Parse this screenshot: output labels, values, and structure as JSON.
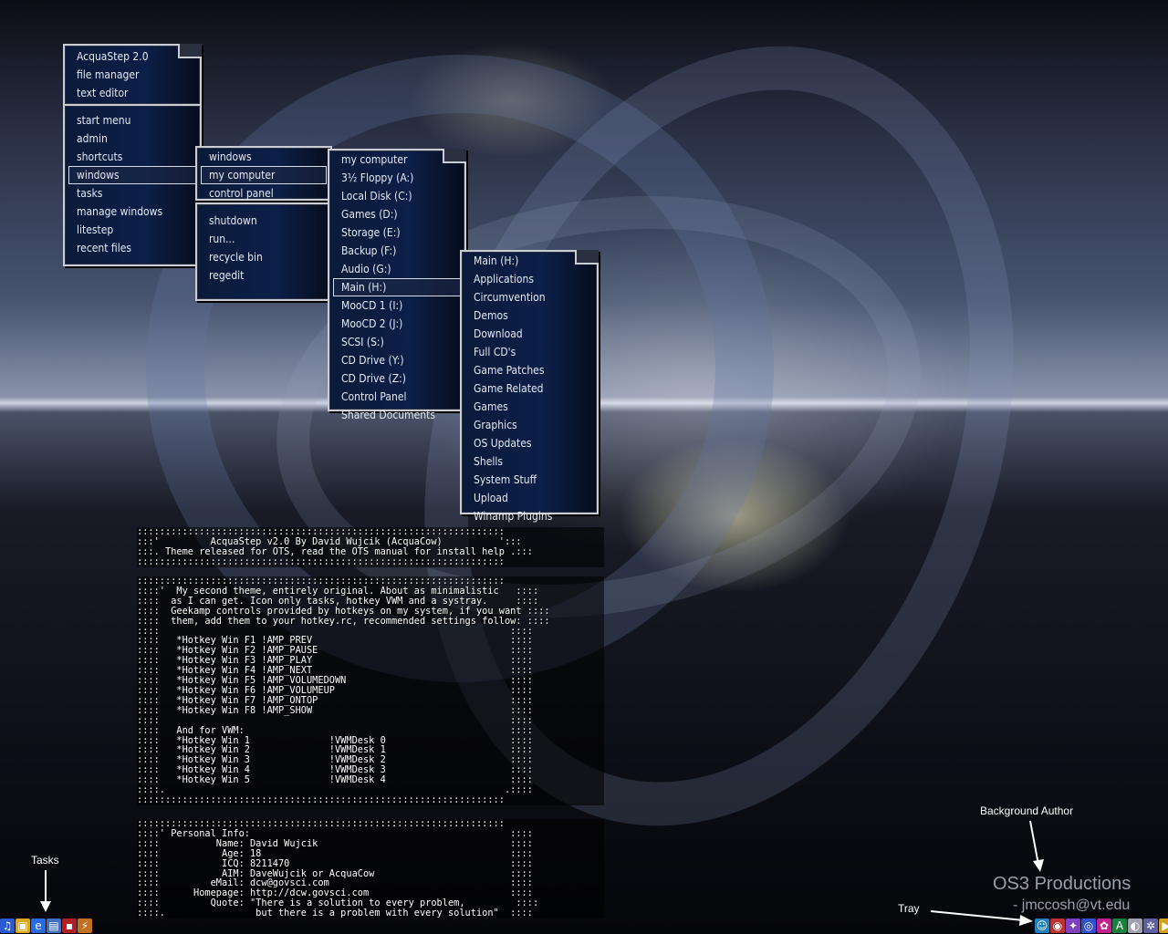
{
  "menus": {
    "start": {
      "groups": [
        [
          "AcquaStep 2.0",
          "file manager",
          "text editor"
        ],
        [
          "start menu",
          "admin",
          "shortcuts",
          "windows",
          "tasks",
          "manage windows",
          "litestep",
          "recent files"
        ]
      ],
      "active": "windows"
    },
    "windows": {
      "groups": [
        [
          "windows",
          "my computer",
          "control panel"
        ],
        [
          "shutdown",
          "run...",
          "recycle bin",
          "regedit"
        ]
      ],
      "active": "my computer"
    },
    "my_computer": {
      "items": [
        "my computer",
        "3½ Floppy (A:)",
        "Local Disk (C:)",
        "Games (D:)",
        "Storage (E:)",
        "Backup (F:)",
        "Audio (G:)",
        "Main (H:)",
        "MooCD 1 (I:)",
        "MooCD 2 (J:)",
        "SCSI (S:)",
        "CD Drive (Y:)",
        "CD Drive (Z:)",
        "Control Panel",
        "Shared Documents"
      ],
      "active": "Main (H:)"
    },
    "main_h": {
      "items": [
        "Main (H:)",
        "Applications",
        "Circumvention",
        "Demos",
        "Download",
        "Full CD's",
        "Game Patches",
        "Game Related",
        "Games",
        "Graphics",
        "OS Updates",
        "Shells",
        "System Stuff",
        "Upload",
        "Winamp Plugins"
      ]
    }
  },
  "readme": {
    "block1": ":::::::::::::::::::::::::::::::::::::::::::::::::::::::::::::::::\n:::'         AcquaStep v2.0 By David Wujcik (AcquaCow)          ':::\n:::. Theme released for OTS, read the OTS manual for install help .:::\n:::::::::::::::::::::::::::::::::::::::::::::::::::::::::::::::::",
    "block2": ":::::::::::::::::::::::::::::::::::::::::::::::::::::::::::::::::\n::::'  My second theme, entirely original. About as minimalistic   ::::\n::::  as I can get. Icon only tasks, hotkey VWM and a systray.     ::::\n::::  Geekamp controls provided by hotkeys on my system, if you want ::::\n::::  them, add them to your hotkey.rc, recommended settings follow: ::::\n::::                                                              ::::\n::::   *Hotkey Win F1 !AMP_PREV                                   ::::\n::::   *Hotkey Win F2 !AMP_PAUSE                                  ::::\n::::   *Hotkey Win F3 !AMP_PLAY                                   ::::\n::::   *Hotkey Win F4 !AMP_NEXT                                   ::::\n::::   *Hotkey Win F5 !AMP_VOLUMEDOWN                             ::::\n::::   *Hotkey Win F6 !AMP_VOLUMEUP                               ::::\n::::   *Hotkey Win F7 !AMP_ONTOP                                  ::::\n::::   *Hotkey Win F8 !AMP_SHOW                                   ::::\n::::                                                              ::::\n::::   And for VWM:                                               ::::\n::::   *Hotkey Win 1              !VWMDesk 0                      ::::\n::::   *Hotkey Win 2              !VWMDesk 1                      ::::\n::::   *Hotkey Win 3              !VWMDesk 2                      ::::\n::::   *Hotkey Win 4              !VWMDesk 3                      ::::\n::::   *Hotkey Win 5              !VWMDesk 4                      ::::\n::::.                                                            .::::\n:::::::::::::::::::::::::::::::::::::::::::::::::::::::::::::::::",
    "block3": ":::::::::::::::::::::::::::::::::::::::::::::::::::::::::::::::::\n::::' Personal Info:                                              ::::\n::::          Name: David Wujcik                                  ::::\n::::           Age: 18                                            ::::\n::::           ICQ: 8211470                                       ::::\n::::           AIM: DaveWujcik or AcquaCow                        ::::\n::::         eMail: dcw@govsci.com                                ::::\n::::      Homepage: http://dcw.govsci.com                         ::::\n::::         Quote: \"There is a solution to every problem,         ::::\n::::.                but there is a problem with every solution\"  ::::"
  },
  "annotations": {
    "tasks": "Tasks",
    "background_author": "Background Author",
    "tray": "Tray"
  },
  "credit": {
    "title": "OS3 Productions",
    "email": "- jmccosh@vt.edu"
  },
  "taskbar_icons": [
    {
      "name": "task-theme-icon",
      "color": "#2a5ad0",
      "glyph": "♫"
    },
    {
      "name": "task-explorer-icon",
      "color": "#d8a820",
      "glyph": "▣"
    },
    {
      "name": "task-ie-icon",
      "color": "#2a6ae0",
      "glyph": "e"
    },
    {
      "name": "task-notepad-icon",
      "color": "#4070c0",
      "glyph": "▤"
    },
    {
      "name": "task-terminal-icon",
      "color": "#b02020",
      "glyph": "▪"
    },
    {
      "name": "task-lightning-icon",
      "color": "#c07020",
      "glyph": "⚡"
    }
  ],
  "tray_icons": [
    {
      "name": "tray-chat-icon",
      "color": "#2080c0",
      "glyph": "☺"
    },
    {
      "name": "tray-network-icon",
      "color": "#c03030",
      "glyph": "◉"
    },
    {
      "name": "tray-rainbow-icon",
      "color": "#8040c0",
      "glyph": "✦"
    },
    {
      "name": "tray-globe-icon",
      "color": "#3050d0",
      "glyph": "◎"
    },
    {
      "name": "tray-flower-icon",
      "color": "#c02090",
      "glyph": "✿"
    },
    {
      "name": "tray-font-icon",
      "color": "#1a8040",
      "glyph": "A"
    },
    {
      "name": "tray-cd-icon",
      "color": "#a0a0b0",
      "glyph": "◐"
    },
    {
      "name": "tray-gear-icon",
      "color": "#6060a0",
      "glyph": "✲"
    },
    {
      "name": "tray-winamp-icon",
      "color": "#d0a020",
      "glyph": "▶"
    }
  ]
}
